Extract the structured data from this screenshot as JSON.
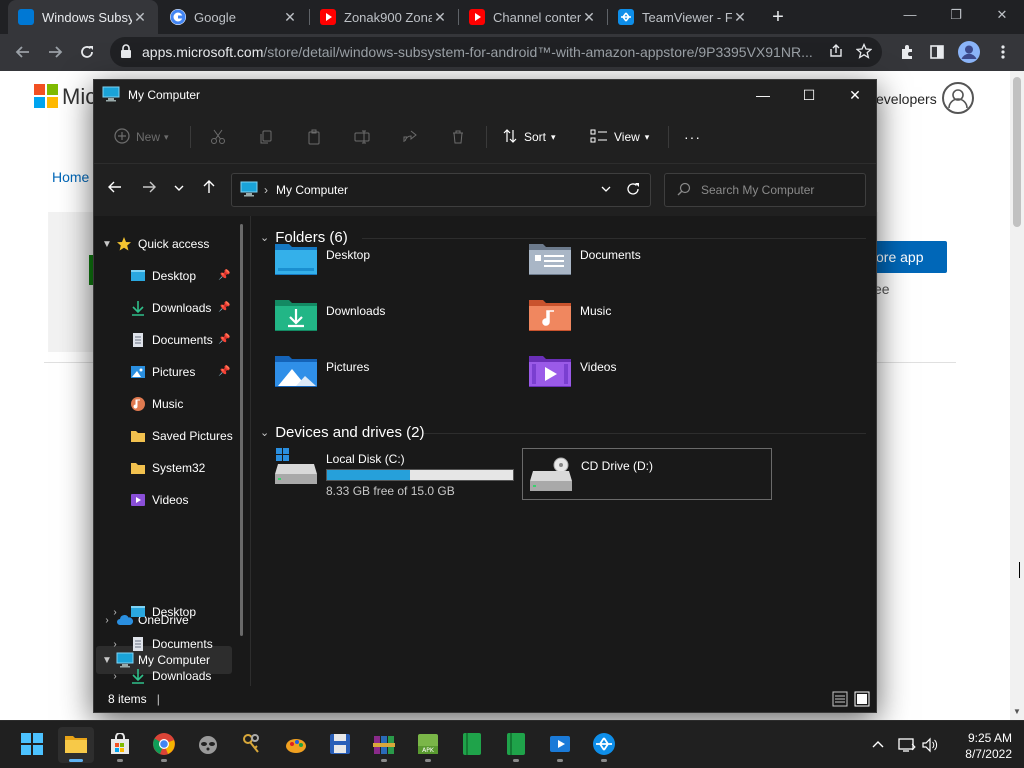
{
  "browser": {
    "tabs": [
      {
        "title": "Windows Subsy",
        "favicon_color": "#0078d4"
      },
      {
        "title": "Google",
        "favicon_color": "#ffffff"
      },
      {
        "title": "Zonak900 Zona",
        "favicon_color": "#ff0000"
      },
      {
        "title": "Channel conten",
        "favicon_color": "#ff0000"
      },
      {
        "title": "TeamViewer - Fr",
        "favicon_color": "#0e8ee9"
      }
    ],
    "new_tab_icon": "+",
    "url_host": "apps.microsoft.com",
    "url_path": "/store/detail/windows-subsystem-for-android™-with-amazon-appstore/9P3395VX91NR..."
  },
  "webpage": {
    "brand": "Mic",
    "developers": "evelopers",
    "home": "Home",
    "store_button": "ore app",
    "free": "ee"
  },
  "explorer": {
    "title": "My Computer",
    "commands": {
      "new": "New",
      "sort": "Sort",
      "view": "View",
      "more": "···"
    },
    "address": {
      "path": "My Computer",
      "sep": "›"
    },
    "search_placeholder": "Search My Computer",
    "sidebar": {
      "quick_access": "Quick access",
      "quick_items": [
        {
          "label": "Desktop",
          "pinned": true
        },
        {
          "label": "Downloads",
          "pinned": true
        },
        {
          "label": "Documents",
          "pinned": true
        },
        {
          "label": "Pictures",
          "pinned": true
        },
        {
          "label": "Music",
          "pinned": false
        },
        {
          "label": "Saved Pictures",
          "pinned": false
        },
        {
          "label": "System32",
          "pinned": false
        },
        {
          "label": "Videos",
          "pinned": false
        }
      ],
      "onedrive": "OneDrive",
      "my_computer": "My Computer",
      "computer_items": [
        "Desktop",
        "Documents",
        "Downloads"
      ]
    },
    "folders_header": "Folders (6)",
    "folders": [
      "Desktop",
      "Documents",
      "Downloads",
      "Music",
      "Pictures",
      "Videos"
    ],
    "drives_header": "Devices and drives (2)",
    "drives": [
      {
        "label": "Local Disk (C:)",
        "free_text": "8.33 GB free of 15.0 GB",
        "used_fraction": 0.445
      },
      {
        "label": "CD Drive (D:)"
      }
    ],
    "status": "8 items",
    "status_sep": "|"
  },
  "taskbar": {
    "time": "9:25 AM",
    "date": "8/7/2022",
    "tray_chevron": "^"
  },
  "colors": {
    "accent": "#0078d4",
    "explorer_bg": "#191919",
    "drive_bar": "#26a0da"
  }
}
